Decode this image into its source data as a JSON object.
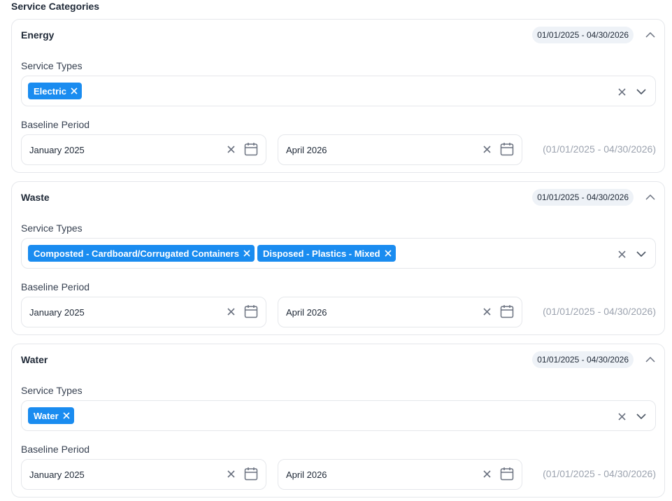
{
  "header": {
    "title": "Service Categories"
  },
  "labels": {
    "service_types": "Service Types",
    "baseline_period": "Baseline Period"
  },
  "categories": [
    {
      "name": "Energy",
      "date_range": "01/01/2025 - 04/30/2026",
      "service_types": [
        "Electric"
      ],
      "baseline_start": "January 2025",
      "baseline_end": "April 2026",
      "range_text": "(01/01/2025 - 04/30/2026)"
    },
    {
      "name": "Waste",
      "date_range": "01/01/2025 - 04/30/2026",
      "service_types": [
        "Composted - Cardboard/Corrugated Containers",
        "Disposed - Plastics - Mixed"
      ],
      "baseline_start": "January 2025",
      "baseline_end": "April 2026",
      "range_text": "(01/01/2025 - 04/30/2026)"
    },
    {
      "name": "Water",
      "date_range": "01/01/2025 - 04/30/2026",
      "service_types": [
        "Water"
      ],
      "baseline_start": "January 2025",
      "baseline_end": "April 2026",
      "range_text": "(01/01/2025 - 04/30/2026)"
    }
  ],
  "colors": {
    "chip": "#1a8cf0",
    "border": "#e5e7eb",
    "pill": "#eef2f7",
    "muted": "#9ca3af"
  },
  "icons": {
    "collapse": "chevron-up-icon",
    "clear": "close-icon",
    "expand": "chevron-down-icon",
    "calendar": "calendar-icon"
  }
}
